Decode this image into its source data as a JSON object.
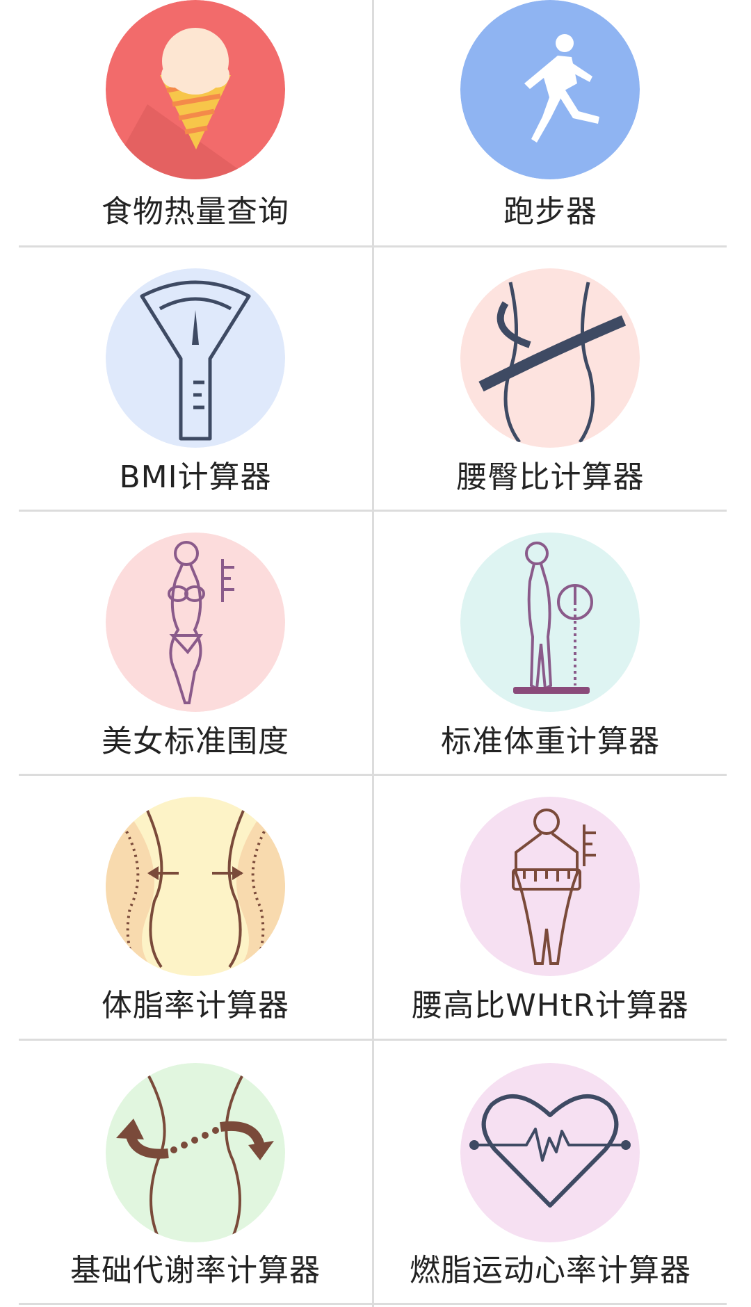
{
  "tools": [
    {
      "label": "食物热量查询",
      "icon": "ice-cream-icon",
      "color": "#f26b6b"
    },
    {
      "label": "跑步器",
      "icon": "runner-icon",
      "color": "#8fb4f2"
    },
    {
      "label": "BMI计算器",
      "icon": "scale-icon",
      "color": "#dfe9fb"
    },
    {
      "label": "腰臀比计算器",
      "icon": "waist-tape-icon",
      "color": "#fde3df"
    },
    {
      "label": "美女标准围度",
      "icon": "female-figure-icon",
      "color": "#fcdcdc"
    },
    {
      "label": "标准体重计算器",
      "icon": "height-scale-icon",
      "color": "#def4f2"
    },
    {
      "label": "体脂率计算器",
      "icon": "body-fat-icon",
      "color": "#fdf3c7"
    },
    {
      "label": "腰高比WHtR计算器",
      "icon": "waist-height-ratio-icon",
      "color": "#f6e0f2"
    },
    {
      "label": "基础代谢率计算器",
      "icon": "metabolism-icon",
      "color": "#e1f6df"
    },
    {
      "label": "燃脂运动心率计算器",
      "icon": "heart-rate-icon",
      "color": "#f6e0f2"
    }
  ]
}
